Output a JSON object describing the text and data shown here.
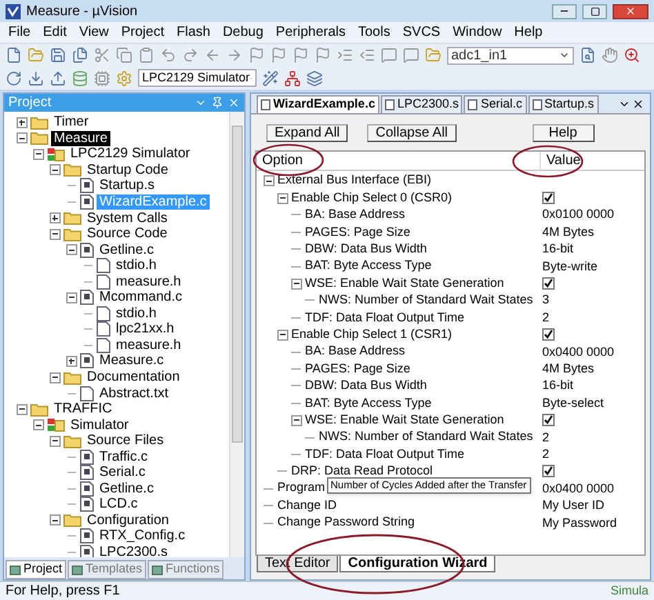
{
  "window": {
    "title": "Measure - µVision"
  },
  "menu": [
    "File",
    "Edit",
    "View",
    "Project",
    "Flash",
    "Debug",
    "Peripherals",
    "Tools",
    "SVCS",
    "Window",
    "Help"
  ],
  "toolbar": {
    "find_combo": "adc1_in1",
    "target_combo": "LPC2129 Simulator"
  },
  "project_panel": {
    "title": "Project",
    "tree": [
      {
        "label": "Timer",
        "kind": "project",
        "active": false,
        "selected": false,
        "expanded": false
      },
      {
        "label": "Measure",
        "kind": "project",
        "active": true,
        "selected": false,
        "expanded": true,
        "children": [
          {
            "label": "LPC2129 Simulator",
            "kind": "target",
            "selected": false,
            "expanded": true,
            "children": [
              {
                "label": "Startup Code",
                "kind": "folder",
                "selected": false,
                "expanded": true,
                "children": [
                  {
                    "label": "Startup.s",
                    "kind": "source",
                    "selected": false
                  },
                  {
                    "label": "WizardExample.c",
                    "kind": "source",
                    "selected": true
                  }
                ]
              },
              {
                "label": "System Calls",
                "kind": "folder",
                "selected": false,
                "expanded": false
              },
              {
                "label": "Source Code",
                "kind": "folder",
                "selected": false,
                "expanded": true,
                "children": [
                  {
                    "label": "Getline.c",
                    "kind": "source",
                    "selected": false,
                    "expanded": true,
                    "children": [
                      {
                        "label": "stdio.h",
                        "kind": "header",
                        "selected": false
                      },
                      {
                        "label": "measure.h",
                        "kind": "header",
                        "selected": false
                      }
                    ]
                  },
                  {
                    "label": "Mcommand.c",
                    "kind": "source",
                    "selected": false,
                    "expanded": true,
                    "children": [
                      {
                        "label": "stdio.h",
                        "kind": "header",
                        "selected": false
                      },
                      {
                        "label": "lpc21xx.h",
                        "kind": "header",
                        "selected": false
                      },
                      {
                        "label": "measure.h",
                        "kind": "header",
                        "selected": false
                      }
                    ]
                  },
                  {
                    "label": "Measure.c",
                    "kind": "source",
                    "selected": false,
                    "expanded": false
                  }
                ]
              },
              {
                "label": "Documentation",
                "kind": "folder",
                "selected": false,
                "expanded": true,
                "children": [
                  {
                    "label": "Abstract.txt",
                    "kind": "header",
                    "selected": false
                  }
                ]
              }
            ]
          }
        ]
      },
      {
        "label": "TRAFFIC",
        "kind": "project",
        "active": false,
        "selected": false,
        "expanded": true,
        "children": [
          {
            "label": "Simulator",
            "kind": "target",
            "selected": false,
            "expanded": true,
            "children": [
              {
                "label": "Source Files",
                "kind": "folder",
                "selected": false,
                "expanded": true,
                "children": [
                  {
                    "label": "Traffic.c",
                    "kind": "source",
                    "selected": false
                  },
                  {
                    "label": "Serial.c",
                    "kind": "source",
                    "selected": false
                  },
                  {
                    "label": "Getline.c",
                    "kind": "source",
                    "selected": false
                  },
                  {
                    "label": "LCD.c",
                    "kind": "source",
                    "selected": false
                  }
                ]
              },
              {
                "label": "Configuration",
                "kind": "folder",
                "selected": false,
                "expanded": true,
                "children": [
                  {
                    "label": "RTX_Config.c",
                    "kind": "source",
                    "selected": false
                  },
                  {
                    "label": "LPC2300.s",
                    "kind": "source",
                    "selected": false
                  }
                ]
              }
            ]
          }
        ]
      }
    ],
    "tabs": [
      {
        "label": "Project",
        "selected": true
      },
      {
        "label": "Templates",
        "selected": false
      },
      {
        "label": "Functions",
        "selected": false
      }
    ]
  },
  "editor": {
    "tabs": [
      {
        "label": "WizardExample.c",
        "selected": true
      },
      {
        "label": "LPC2300.s",
        "selected": false
      },
      {
        "label": "Serial.c",
        "selected": false
      },
      {
        "label": "Startup.s",
        "selected": false
      }
    ],
    "buttons": [
      "Expand All",
      "Collapse All",
      "Help"
    ],
    "columns": [
      "Option",
      "Value"
    ],
    "rows": [
      {
        "label": "External Bus Interface (EBI)",
        "expanded": true,
        "children": [
          {
            "label": "Enable Chip Select 0 (CSR0)",
            "kind": "checkbox",
            "checked": true,
            "expanded": true,
            "children": [
              {
                "label": "BA: Base Address",
                "kind": "text",
                "value": "0x0100 0000"
              },
              {
                "label": "PAGES: Page Size",
                "kind": "text",
                "value": "4M Bytes"
              },
              {
                "label": "DBW: Data Bus Width",
                "kind": "text",
                "value": "16-bit"
              },
              {
                "label": "BAT: Byte Access Type",
                "kind": "text",
                "value": "Byte-write"
              },
              {
                "label": "WSE: Enable Wait State Generation",
                "kind": "checkbox",
                "checked": true,
                "expanded": true,
                "children": [
                  {
                    "label": "NWS: Number of Standard Wait States",
                    "kind": "text",
                    "value": "3"
                  }
                ]
              },
              {
                "label": "TDF: Data Float Output Time",
                "kind": "text",
                "value": "2"
              }
            ]
          },
          {
            "label": "Enable Chip Select 1 (CSR1)",
            "kind": "checkbox",
            "checked": true,
            "expanded": true,
            "children": [
              {
                "label": "BA: Base Address",
                "kind": "text",
                "value": "0x0400 0000"
              },
              {
                "label": "PAGES: Page Size",
                "kind": "text",
                "value": "4M Bytes"
              },
              {
                "label": "DBW: Data Bus Width",
                "kind": "text",
                "value": "16-bit"
              },
              {
                "label": "BAT: Byte Access Type",
                "kind": "text",
                "value": "Byte-select"
              },
              {
                "label": "WSE: Enable Wait State Generation",
                "kind": "checkbox",
                "checked": true,
                "expanded": true,
                "children": [
                  {
                    "label": "NWS: Number of Standard Wait States",
                    "kind": "text",
                    "value": "2"
                  }
                ]
              },
              {
                "label": "TDF: Data Float Output Time",
                "kind": "text",
                "value": "2"
              }
            ]
          },
          {
            "label": "DRP: Data Read Protocol",
            "kind": "checkbox",
            "checked": true
          }
        ]
      },
      {
        "label": "Program",
        "kind": "text",
        "value": "0x0400 0000"
      },
      {
        "label": "Change ID",
        "kind": "text",
        "value": "My User ID"
      },
      {
        "label": "Change Password String",
        "kind": "text",
        "value": "My Password"
      }
    ],
    "tooltip": "Number of Cycles Added after the Transfer",
    "bottom_tabs": [
      {
        "label": "Text Editor",
        "selected": false
      },
      {
        "label": "Configuration Wizard",
        "selected": true
      }
    ]
  },
  "status_bar": {
    "help": "For Help, press F1",
    "mode": "Simula"
  }
}
